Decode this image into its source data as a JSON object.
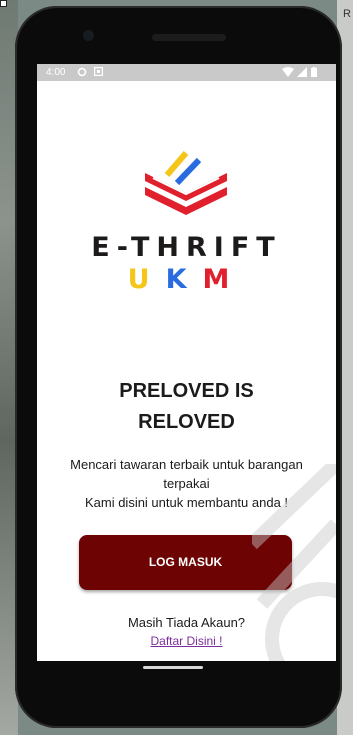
{
  "status_bar": {
    "time": "4:00"
  },
  "brand": {
    "line1": "E-THRIFT",
    "line2": [
      "U",
      "K",
      "M"
    ]
  },
  "headline": {
    "line1": "PRELOVED IS",
    "line2": "RELOVED"
  },
  "subtext": {
    "line1": "Mencari tawaran terbaik untuk barangan",
    "line2": "terpakai",
    "line3": "Kami disini untuk membantu anda !"
  },
  "login": {
    "label": "LOG MASUK"
  },
  "signup": {
    "prompt": "Masih Tiada Akaun?",
    "link": "Daftar Disini !"
  },
  "colors": {
    "login_button": "#6e0303",
    "brand_yellow": "#f5c518",
    "brand_blue": "#2a6be0",
    "brand_red": "#e1202e",
    "link": "#7b2d9b"
  },
  "icons": [
    "location-icon",
    "notification-icon",
    "wifi-icon",
    "signal-icon",
    "battery-icon"
  ]
}
